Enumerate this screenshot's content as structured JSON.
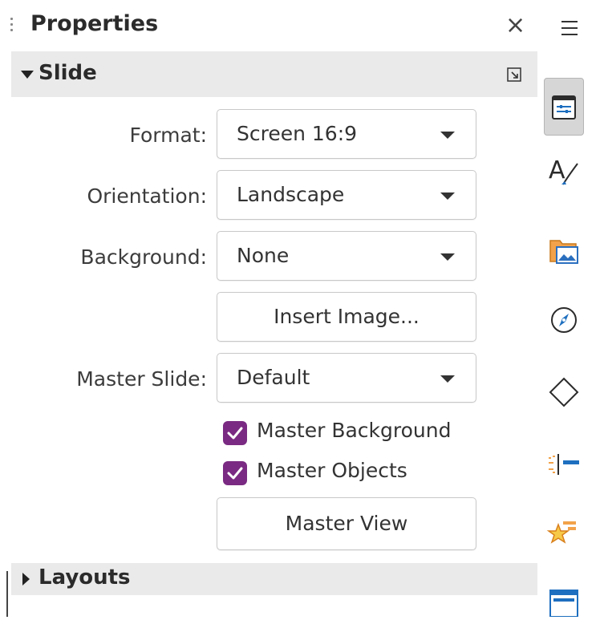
{
  "panel": {
    "title": "Properties",
    "close_glyph": "×"
  },
  "slide_section": {
    "title": "Slide",
    "rows": {
      "format_label": "Format:",
      "format_value": "Screen 16:9",
      "orientation_label": "Orientation:",
      "orientation_value": "Landscape",
      "background_label": "Background:",
      "background_value": "None",
      "insert_image_label": "Insert Image...",
      "master_slide_label": "Master Slide:",
      "master_slide_value": "Default",
      "master_background_label": "Master Background",
      "master_background_checked": true,
      "master_objects_label": "Master Objects",
      "master_objects_checked": true,
      "master_view_label": "Master View"
    }
  },
  "layouts_section": {
    "title": "Layouts"
  },
  "tab_bar": {
    "tabs": [
      {
        "icon": "properties-icon",
        "active": true
      },
      {
        "icon": "styles-icon"
      },
      {
        "icon": "gallery-icon"
      },
      {
        "icon": "navigator-icon"
      },
      {
        "icon": "shapes-icon"
      },
      {
        "icon": "slide-transition-icon"
      },
      {
        "icon": "animation-icon"
      },
      {
        "icon": "master-slides-icon"
      }
    ]
  },
  "colors": {
    "checkbox": "#7a2a82",
    "section_header_bg": "#eaeaea",
    "active_tab_bg": "#d6d6d6"
  }
}
